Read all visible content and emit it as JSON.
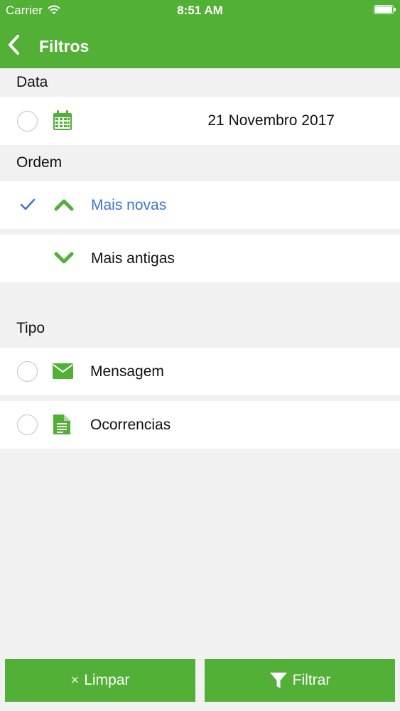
{
  "status_bar": {
    "carrier": "Carrier",
    "time": "8:51 AM"
  },
  "nav": {
    "title": "Filtros",
    "back_icon": "chevron-left-icon"
  },
  "sections": {
    "data": {
      "header": "Data",
      "date_value": "21 Novembro 2017",
      "icon": "calendar-icon",
      "selected": false
    },
    "ordem": {
      "header": "Ordem",
      "options": [
        {
          "label": "Mais novas",
          "icon": "chevron-up-icon",
          "selected": true
        },
        {
          "label": "Mais antigas",
          "icon": "chevron-down-icon",
          "selected": false
        }
      ]
    },
    "tipo": {
      "header": "Tipo",
      "options": [
        {
          "label": "Mensagem",
          "icon": "envelope-icon",
          "selected": false
        },
        {
          "label": "Ocorrencias",
          "icon": "document-icon",
          "selected": false
        }
      ]
    }
  },
  "buttons": {
    "clear_glyph": "×",
    "clear_label": "Limpar",
    "filter_label": "Filtrar",
    "filter_icon": "funnel-icon"
  },
  "colors": {
    "brand_green": "#51b035",
    "selected_blue": "#3b74d6",
    "background": "#f1f1f2"
  }
}
